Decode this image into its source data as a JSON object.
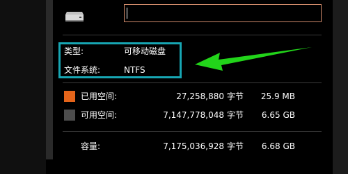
{
  "header": {
    "icon": "drive-icon",
    "name_value": ""
  },
  "info": {
    "type_label": "类型:",
    "type_value": "可移动磁盘",
    "fs_label": "文件系统:",
    "fs_value": "NTFS"
  },
  "space": {
    "used": {
      "label": "已用空间:",
      "bytes": "27,258,880",
      "unit": "字节",
      "size": "25.9 MB",
      "color": "#e4641a"
    },
    "free": {
      "label": "可用空间:",
      "bytes": "7,147,778,048",
      "unit": "字节",
      "size": "6.65 GB",
      "color": "#4d4d4d"
    },
    "capacity": {
      "label": "容量:",
      "bytes": "7,175,036,928",
      "unit": "字节",
      "size": "6.68 GB"
    }
  },
  "annotation": {
    "box_color": "#17a6b3",
    "arrow_color": "#22d41a"
  }
}
